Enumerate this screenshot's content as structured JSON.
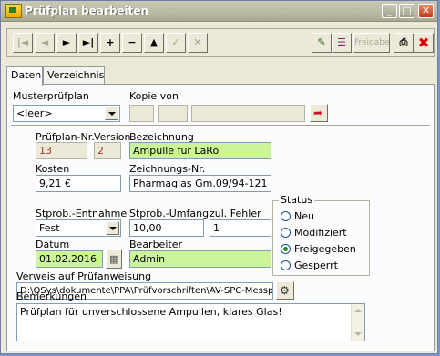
{
  "window": {
    "title": "Prüfplan bearbeiten"
  },
  "toolbar": {
    "first": "|◄",
    "prev": "◄",
    "next": "►",
    "last": "►|",
    "add": "+",
    "remove": "−",
    "up": "▲",
    "edit": "✓",
    "cancel": "✕",
    "release_label": "Freigabe",
    "print": "⎙",
    "delete": "✖"
  },
  "tabs": [
    {
      "label": "Daten"
    },
    {
      "label": "Verzeichnis"
    }
  ],
  "form": {
    "musterpruefplan": {
      "label": "Musterprüfplan",
      "value": "<leer>"
    },
    "kopie_von": {
      "label": "Kopie von"
    },
    "pruefplan_nr": {
      "label": "Prüfplan-Nr.",
      "value": "13"
    },
    "version": {
      "label": "Version",
      "value": "2"
    },
    "bezeichnung": {
      "label": "Bezeichnung",
      "value": "Ampulle für LaRo"
    },
    "kosten": {
      "label": "Kosten",
      "value": "9,21 €"
    },
    "zeichnungs_nr": {
      "label": "Zeichnungs-Nr.",
      "value": "Pharmaglas Gm.09/94-121"
    },
    "strprob_entnahme": {
      "label": "Stprob.-Entnahme",
      "value": "Fest"
    },
    "strprob_umfang": {
      "label": "Stprob.-Umfang",
      "value": "10,00"
    },
    "zul_fehler": {
      "label": "zul. Fehler",
      "value": "1"
    },
    "datum": {
      "label": "Datum",
      "value": "01.02.2016"
    },
    "bearbeiter": {
      "label": "Bearbeiter",
      "value": "Admin"
    },
    "verweis": {
      "label": "Verweis auf Prüfanweisung",
      "value": "D:\\QSys\\dokumente\\PPA\\Prüfvorschriften\\AV-SPC-Messplatz_C"
    },
    "bemerkungen": {
      "label": "Bemerkungen",
      "value": "Prüfplan für unverschlossene Ampullen, klares Glas!"
    },
    "status": {
      "label": "Status",
      "options": [
        "Neu",
        "Modifiziert",
        "Freigegeben",
        "Gesperrt"
      ],
      "selected": "Freigegeben"
    }
  }
}
